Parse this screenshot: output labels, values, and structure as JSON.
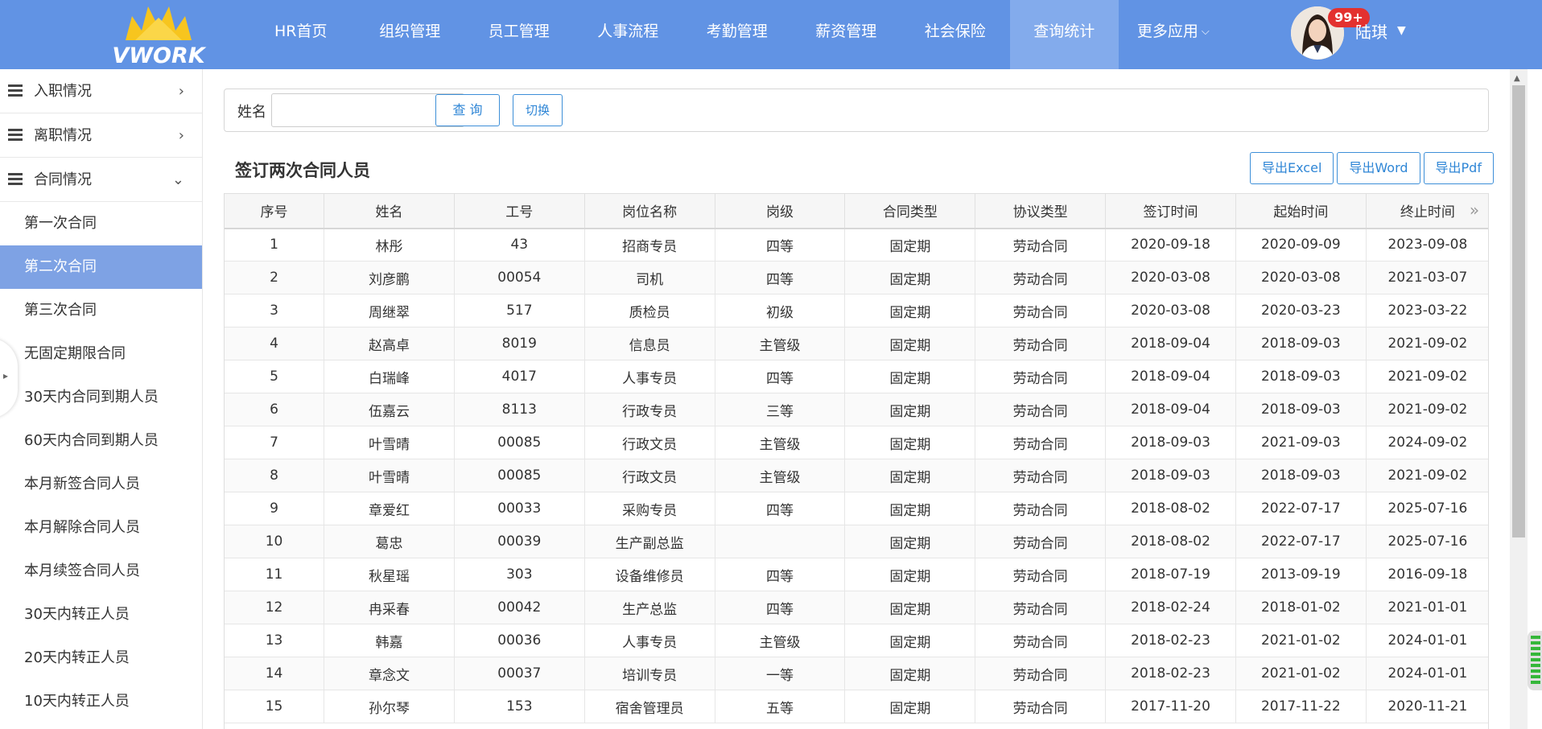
{
  "brand": {
    "logo_text": "VWORK"
  },
  "nav": {
    "items": [
      {
        "label": "HR首页"
      },
      {
        "label": "组织管理"
      },
      {
        "label": "员工管理"
      },
      {
        "label": "人事流程"
      },
      {
        "label": "考勤管理"
      },
      {
        "label": "薪资管理"
      },
      {
        "label": "社会保险"
      },
      {
        "label": "查询统计"
      },
      {
        "label": "更多应用"
      }
    ],
    "active_index": 7
  },
  "user": {
    "name": "陆琪",
    "badge": "99+"
  },
  "sidebar": {
    "groups": [
      {
        "label": "入职情况",
        "arrow": "›"
      },
      {
        "label": "离职情况",
        "arrow": "›"
      },
      {
        "label": "合同情况",
        "arrow": "⌄"
      }
    ],
    "subitems": [
      {
        "label": "第一次合同"
      },
      {
        "label": "第二次合同"
      },
      {
        "label": "第三次合同"
      },
      {
        "label": "无固定期限合同"
      },
      {
        "label": "30天内合同到期人员"
      },
      {
        "label": "60天内合同到期人员"
      },
      {
        "label": "本月新签合同人员"
      },
      {
        "label": "本月解除合同人员"
      },
      {
        "label": "本月续签合同人员"
      },
      {
        "label": "30天内转正人员"
      },
      {
        "label": "20天内转正人员"
      },
      {
        "label": "10天内转正人员"
      }
    ],
    "active_sub_index": 1
  },
  "search": {
    "label": "姓名",
    "value": "",
    "placeholder": "",
    "query_button": "查 询",
    "toggle_button": "切换"
  },
  "section": {
    "title": "签订两次合同人员"
  },
  "export": {
    "excel": "导出Excel",
    "word": "导出Word",
    "pdf": "导出Pdf"
  },
  "table": {
    "headers": [
      "序号",
      "姓名",
      "工号",
      "岗位名称",
      "岗级",
      "合同类型",
      "协议类型",
      "签订时间",
      "起始时间",
      "终止时间"
    ],
    "more_cols_icon": "»",
    "rows": [
      [
        "1",
        "林彤",
        "43",
        "招商专员",
        "四等",
        "固定期",
        "劳动合同",
        "2020-09-18",
        "2020-09-09",
        "2023-09-08"
      ],
      [
        "2",
        "刘彦鹏",
        "00054",
        "司机",
        "四等",
        "固定期",
        "劳动合同",
        "2020-03-08",
        "2020-03-08",
        "2021-03-07"
      ],
      [
        "3",
        "周继翠",
        "517",
        "质检员",
        "初级",
        "固定期",
        "劳动合同",
        "2020-03-08",
        "2020-03-23",
        "2023-03-22"
      ],
      [
        "4",
        "赵高卓",
        "8019",
        "信息员",
        "主管级",
        "固定期",
        "劳动合同",
        "2018-09-04",
        "2018-09-03",
        "2021-09-02"
      ],
      [
        "5",
        "白瑞峰",
        "4017",
        "人事专员",
        "四等",
        "固定期",
        "劳动合同",
        "2018-09-04",
        "2018-09-03",
        "2021-09-02"
      ],
      [
        "6",
        "伍嘉云",
        "8113",
        "行政专员",
        "三等",
        "固定期",
        "劳动合同",
        "2018-09-04",
        "2018-09-03",
        "2021-09-02"
      ],
      [
        "7",
        "叶雪晴",
        "00085",
        "行政文员",
        "主管级",
        "固定期",
        "劳动合同",
        "2018-09-03",
        "2021-09-03",
        "2024-09-02"
      ],
      [
        "8",
        "叶雪晴",
        "00085",
        "行政文员",
        "主管级",
        "固定期",
        "劳动合同",
        "2018-09-03",
        "2018-09-03",
        "2021-09-02"
      ],
      [
        "9",
        "章爱红",
        "00033",
        "采购专员",
        "四等",
        "固定期",
        "劳动合同",
        "2018-08-02",
        "2022-07-17",
        "2025-07-16"
      ],
      [
        "10",
        "葛忠",
        "00039",
        "生产副总监",
        "",
        "固定期",
        "劳动合同",
        "2018-08-02",
        "2022-07-17",
        "2025-07-16"
      ],
      [
        "11",
        "秋星瑶",
        "303",
        "设备维修员",
        "四等",
        "固定期",
        "劳动合同",
        "2018-07-19",
        "2013-09-19",
        "2016-09-18"
      ],
      [
        "12",
        "冉采春",
        "00042",
        "生产总监",
        "四等",
        "固定期",
        "劳动合同",
        "2018-02-24",
        "2018-01-02",
        "2021-01-01"
      ],
      [
        "13",
        "韩嘉",
        "00036",
        "人事专员",
        "主管级",
        "固定期",
        "劳动合同",
        "2018-02-23",
        "2021-01-02",
        "2024-01-01"
      ],
      [
        "14",
        "章念文",
        "00037",
        "培训专员",
        "一等",
        "固定期",
        "劳动合同",
        "2018-02-23",
        "2021-01-02",
        "2024-01-01"
      ],
      [
        "15",
        "孙尔琴",
        "153",
        "宿舍管理员",
        "五等",
        "固定期",
        "劳动合同",
        "2017-11-20",
        "2017-11-22",
        "2020-11-21"
      ]
    ]
  },
  "colors": {
    "topbar": "#6193e4",
    "nav_active": "#83abec",
    "sidebar_active": "#7ea2e4",
    "button_text": "#2f86d6",
    "badge": "#e3312f"
  }
}
